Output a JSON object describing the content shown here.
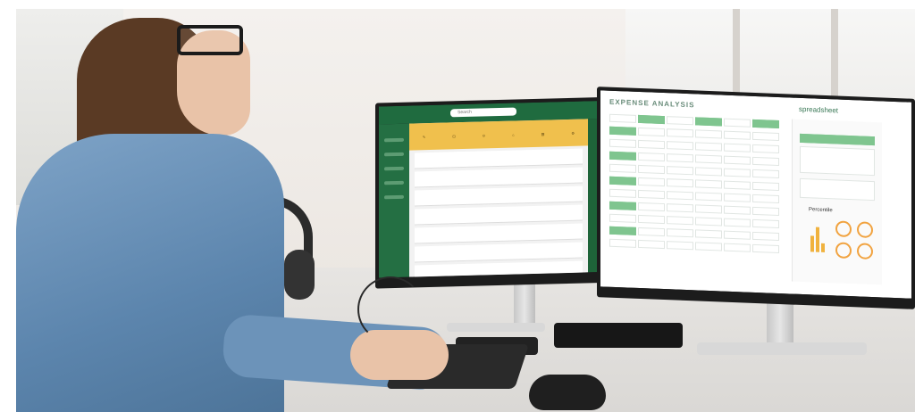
{
  "left_monitor": {
    "app_brand": "",
    "toolbar_items": [
      "",
      "",
      "",
      "",
      "",
      ""
    ]
  },
  "right_monitor": {
    "sheet_title": "EXPENSE ANALYSIS",
    "brand_label": "spreadsheet",
    "chart_title": "Percentile"
  },
  "colors": {
    "primary_green": "#1f6b3f",
    "accent_yellow": "#f0c04d",
    "sheet_green": "#7fc58f"
  }
}
